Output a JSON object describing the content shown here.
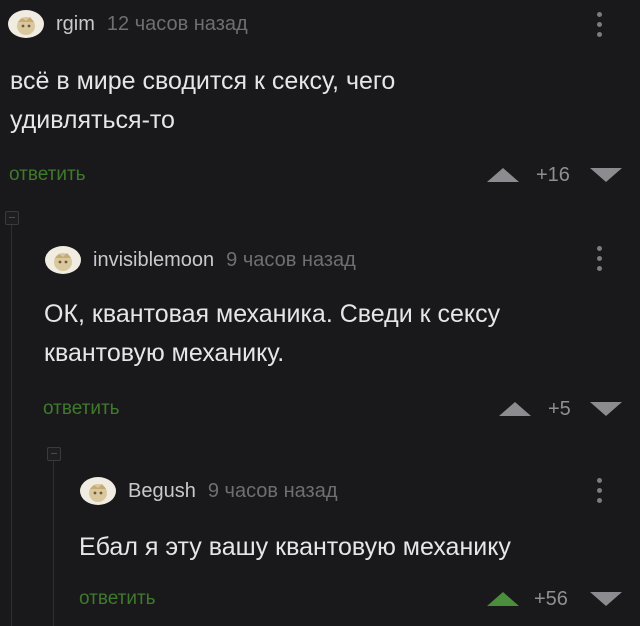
{
  "comments": [
    {
      "username": "rgim",
      "time": "12 часов назад",
      "text": "всё в мире сводится к сексу, чего удивляться-то",
      "reply_label": "ответить",
      "score": "+16",
      "upvoted": false
    },
    {
      "username": "invisiblemoon",
      "time": "9 часов назад",
      "text": "ОК, квантовая механика. Сведи к сексу квантовую механику.",
      "reply_label": "ответить",
      "score": "+5",
      "upvoted": false
    },
    {
      "username": "Begush",
      "time": "9 часов назад",
      "text": "Ебал я эту вашу квантовую механику",
      "reply_label": "ответить",
      "score": "+56",
      "upvoted": true
    }
  ]
}
